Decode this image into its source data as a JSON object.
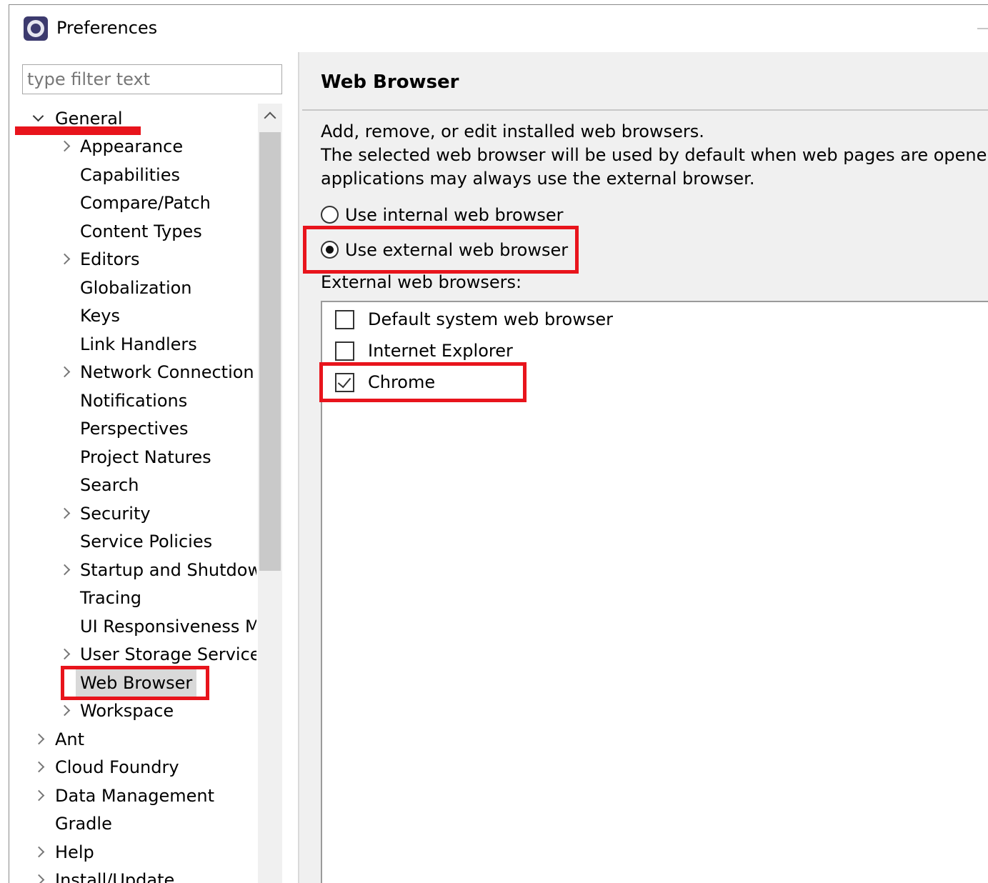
{
  "window": {
    "title": "Preferences"
  },
  "filter": {
    "placeholder": "type filter text"
  },
  "tree": {
    "general": "General",
    "general_children": [
      "Appearance",
      "Capabilities",
      "Compare/Patch",
      "Content Types",
      "Editors",
      "Globalization",
      "Keys",
      "Link Handlers",
      "Network Connection",
      "Notifications",
      "Perspectives",
      "Project Natures",
      "Search",
      "Security",
      "Service Policies",
      "Startup and Shutdow",
      "Tracing",
      "UI Responsiveness M",
      "User Storage Service",
      "Web Browser",
      "Workspace"
    ],
    "top_level": [
      "Ant",
      "Cloud Foundry",
      "Data Management",
      "Gradle",
      "Help",
      "Install/Update"
    ],
    "selected": "Web Browser"
  },
  "page": {
    "title": "Web Browser",
    "description": [
      "Add, remove, or edit installed web browsers.",
      "The selected web browser will be used by default when web pages are opene",
      "applications may always use the external browser."
    ],
    "radio_internal": "Use internal web browser",
    "radio_external": "Use external web browser",
    "selected_mode": "external",
    "external_label": "External web browsers:",
    "browsers": [
      {
        "name": "Default system web browser",
        "checked": false
      },
      {
        "name": "Internet Explorer",
        "checked": false
      },
      {
        "name": "Chrome",
        "checked": true
      }
    ]
  },
  "colors": {
    "highlight_red": "#e8141c",
    "panel_bg": "#f0f0f0",
    "selection_bg": "#d9d9d9"
  }
}
